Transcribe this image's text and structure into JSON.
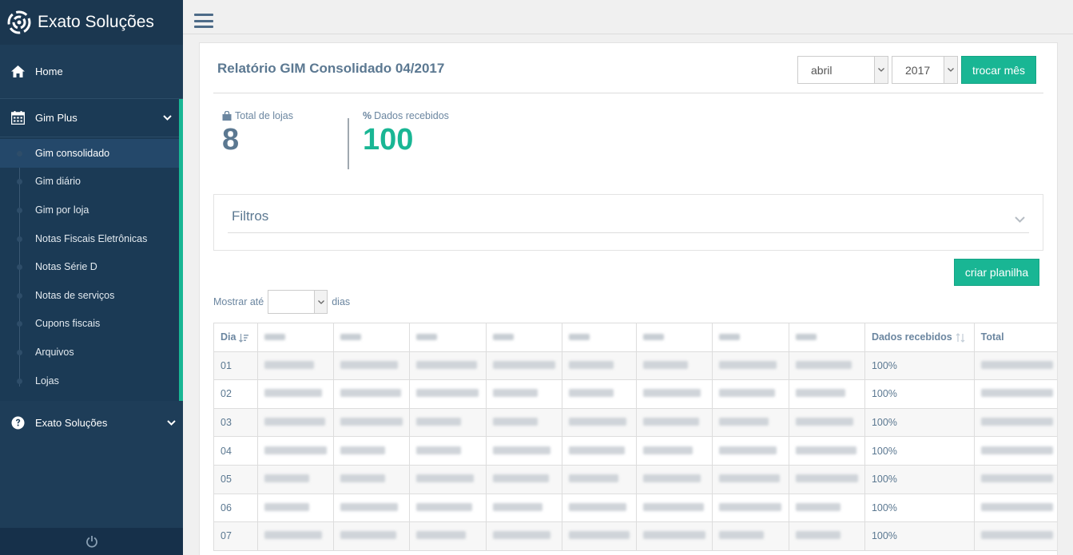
{
  "brand": {
    "name": "Exato Soluções"
  },
  "nav": {
    "home": "Home",
    "group": {
      "label": "Gim Plus",
      "items": [
        "Gim consolidado",
        "Gim diário",
        "Gim por loja",
        "Notas Fiscais Eletrônicas",
        "Notas Série D",
        "Notas de serviços",
        "Cupons fiscais",
        "Arquivos",
        "Lojas"
      ],
      "active_index": 0
    },
    "exato": "Exato Soluções"
  },
  "page": {
    "title": "Relatório GIM Consolidado 04/2017",
    "month_select": "abril",
    "year_select": "2017",
    "change_month_button": "trocar mês"
  },
  "stats": {
    "stores_label": "Total de lojas",
    "stores_value": "8",
    "received_label": "Dados recebidos",
    "received_symbol": "%",
    "received_value": "100"
  },
  "filters": {
    "title": "Filtros"
  },
  "actions": {
    "create_sheet_button": "criar planilha"
  },
  "show": {
    "prefix": "Mostrar até",
    "suffix": "dias"
  },
  "table": {
    "columns": [
      "Dia",
      "",
      "",
      "",
      "",
      "",
      "",
      "",
      "",
      "Dados recebidos",
      "Total"
    ],
    "rows": [
      {
        "day": "01",
        "received": "100%"
      },
      {
        "day": "02",
        "received": "100%"
      },
      {
        "day": "03",
        "received": "100%"
      },
      {
        "day": "04",
        "received": "100%"
      },
      {
        "day": "05",
        "received": "100%"
      },
      {
        "day": "06",
        "received": "100%"
      },
      {
        "day": "07",
        "received": "100%"
      }
    ]
  },
  "colors": {
    "sidebar": "#1e3d58",
    "accent": "#19b694",
    "title": "#5b7891",
    "stat_primary": "#5b7891"
  }
}
